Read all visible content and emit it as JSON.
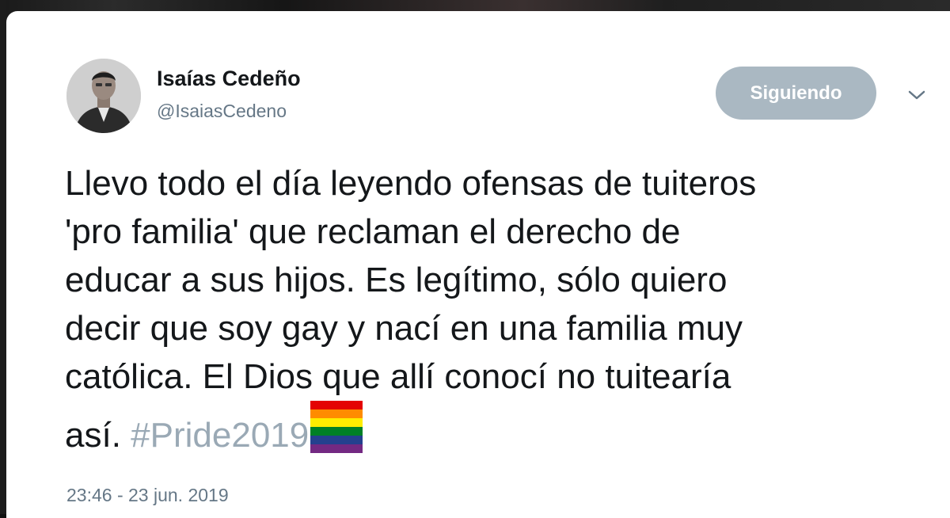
{
  "tweet": {
    "author_name": "Isaías Cedeño",
    "author_handle": "@IsaiasCedeno",
    "follow_label": "Siguiendo",
    "text": "Llevo todo el día leyendo ofensas de tuiteros\n'pro familia' que reclaman el derecho de\neducar a sus hijos. Es legítimo, sólo quiero\ndecir que soy gay y nací en una familia muy\ncatólica. El Dios que allí conocí no tuitearía\nasí. ",
    "hashtag": "#Pride2019",
    "emoji": "rainbow-flag-icon",
    "timestamp": "23:46 - 23 jun. 2019"
  },
  "icons": {
    "menu": "chevron-down-icon",
    "avatar": "avatar"
  },
  "colors": {
    "follow_button_bg": "#aab8c2",
    "hashtag": "#9aa9b5",
    "secondary_text": "#657786",
    "primary_text": "#14171a"
  }
}
